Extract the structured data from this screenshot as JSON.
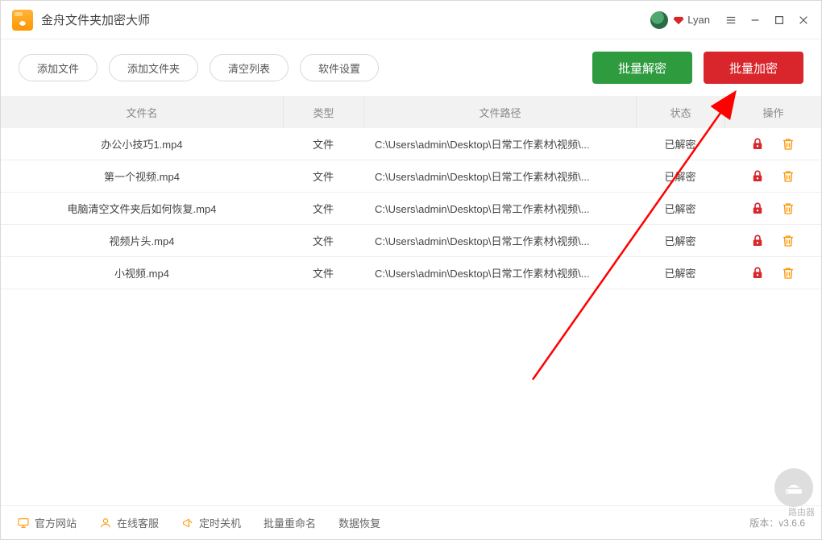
{
  "app": {
    "title": "金舟文件夹加密大师"
  },
  "user": {
    "name": "Lyan"
  },
  "toolbar": {
    "add_file": "添加文件",
    "add_folder": "添加文件夹",
    "clear_list": "清空列表",
    "settings": "软件设置",
    "batch_decrypt": "批量解密",
    "batch_encrypt": "批量加密"
  },
  "columns": {
    "name": "文件名",
    "type": "类型",
    "path": "文件路径",
    "status": "状态",
    "action": "操作"
  },
  "rows": [
    {
      "name": "办公小技巧1.mp4",
      "type": "文件",
      "path": "C:\\Users\\admin\\Desktop\\日常工作素材\\视频\\...",
      "status": "已解密"
    },
    {
      "name": "第一个视频.mp4",
      "type": "文件",
      "path": "C:\\Users\\admin\\Desktop\\日常工作素材\\视频\\...",
      "status": "已解密"
    },
    {
      "name": "电脑清空文件夹后如何恢复.mp4",
      "type": "文件",
      "path": "C:\\Users\\admin\\Desktop\\日常工作素材\\视频\\...",
      "status": "已解密"
    },
    {
      "name": "视频片头.mp4",
      "type": "文件",
      "path": "C:\\Users\\admin\\Desktop\\日常工作素材\\视频\\...",
      "status": "已解密"
    },
    {
      "name": "小视频.mp4",
      "type": "文件",
      "path": "C:\\Users\\admin\\Desktop\\日常工作素材\\视频\\...",
      "status": "已解密"
    }
  ],
  "footer": {
    "website": "官方网站",
    "support": "在线客服",
    "shutdown": "定时关机",
    "rename": "批量重命名",
    "recover": "数据恢复",
    "version": "版本：v3.6.6",
    "router_label": "路由器"
  }
}
